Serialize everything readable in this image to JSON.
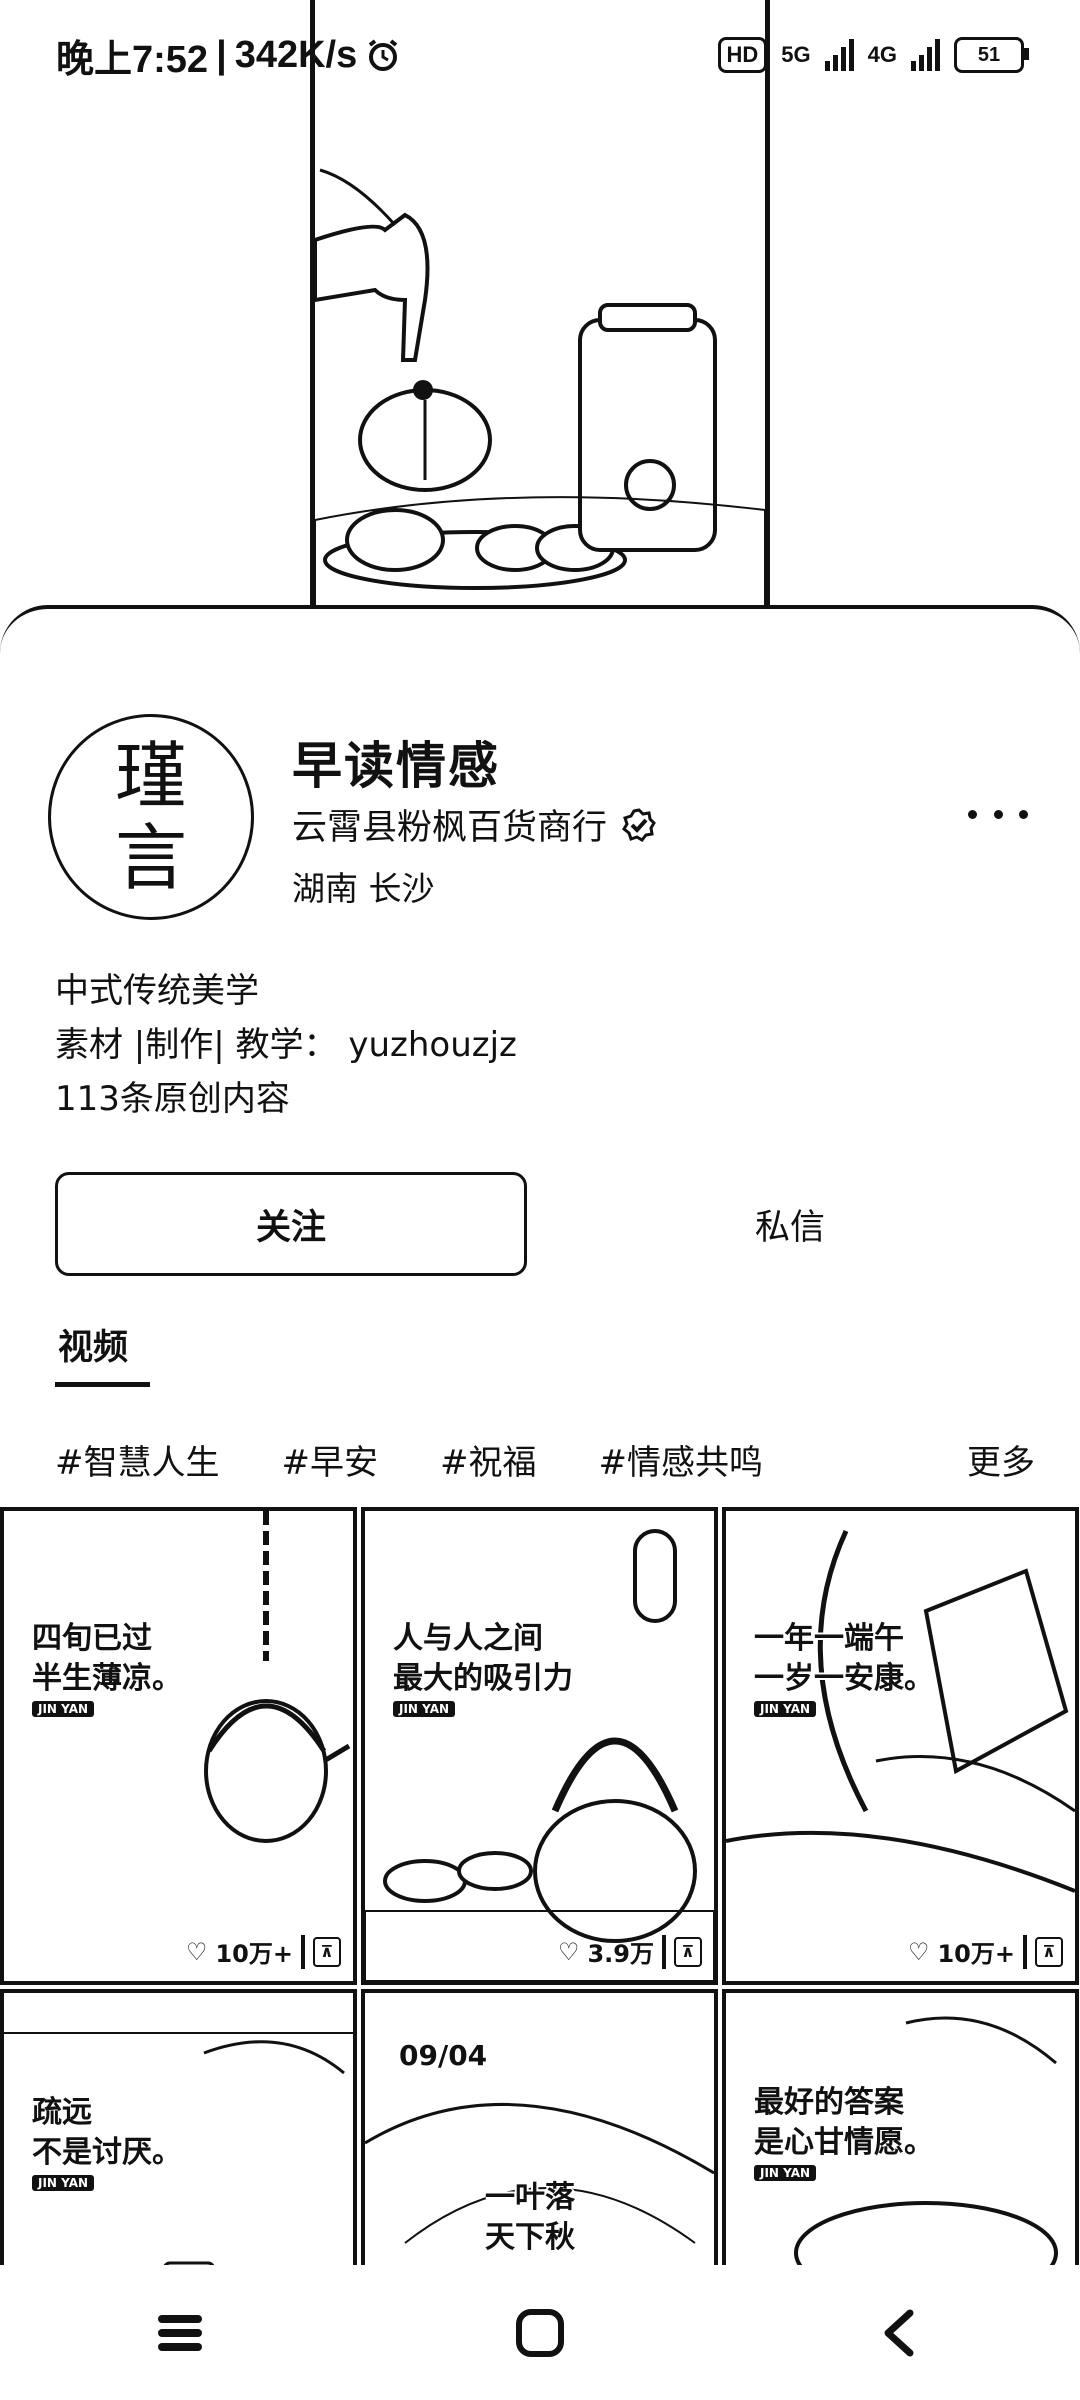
{
  "status_bar": {
    "time": "晚上7:52",
    "speed": "342K/s",
    "hd_label": "HD",
    "net_5g": "5G",
    "net_4g": "4G",
    "battery": "51"
  },
  "profile": {
    "avatar_text_top": "瑾",
    "avatar_text_bottom": "言",
    "username": "早读情感",
    "store_name": "云霄县粉枫百货商行",
    "location": "湖南 长沙",
    "bio_line1": "中式传统美学",
    "bio_line2": "素材 |制作| 教学： yuzhouzjz",
    "content_count": "113条原创内容"
  },
  "actions": {
    "follow_label": "关注",
    "message_label": "私信"
  },
  "tabs": {
    "video_label": "视频"
  },
  "tags": {
    "items": [
      "#智慧人生",
      "#早安",
      "#祝福",
      "#情感共鸣"
    ],
    "more_label": "更多"
  },
  "videos": [
    {
      "caption": "四旬已过\n半生薄凉。",
      "brand": "JIN YAN",
      "likes": "10万+"
    },
    {
      "caption": "人与人之间\n最大的吸引力",
      "brand": "JIN YAN",
      "likes": "3.9万"
    },
    {
      "caption": "一年一端午\n一岁一安康。",
      "brand": "JIN YAN",
      "likes": "10万+"
    },
    {
      "caption": "疏远\n不是讨厌。",
      "brand": "JIN YAN"
    },
    {
      "date": "09/04",
      "caption": "一叶落\n天下秋"
    },
    {
      "caption": "最好的答案\n是心甘情愿。",
      "brand": "JIN YAN"
    }
  ],
  "icons": {
    "verified": "verified-badge-icon",
    "more": "more-dots-icon",
    "heart": "heart-icon",
    "pin": "pin-icon",
    "menu": "menu-icon",
    "home": "home-icon",
    "back": "back-icon",
    "alarm": "alarm-icon"
  }
}
